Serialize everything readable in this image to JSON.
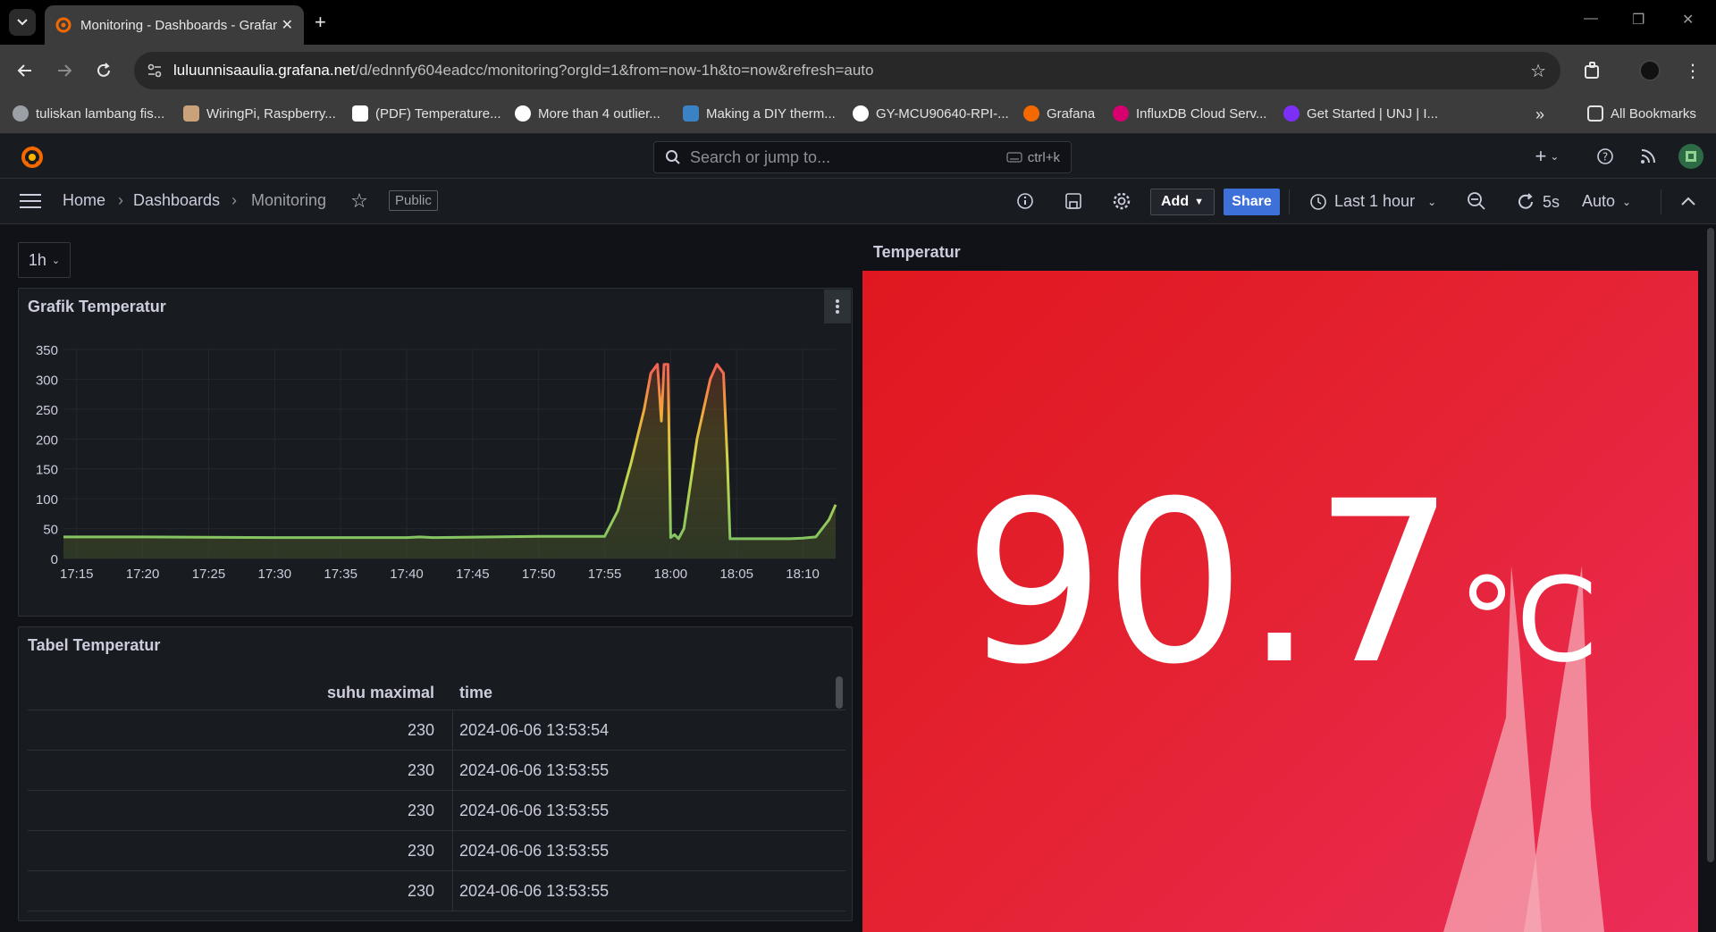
{
  "browser": {
    "tab_title": "Monitoring - Dashboards - Grafana",
    "url_host": "luluunnisaaulia.grafana.net",
    "url_path": "/d/ednnfy604eadcc/monitoring?orgId=1&from=now-1h&to=now&refresh=auto",
    "bookmarks": [
      "tuliskan lambang fis...",
      "WiringPi, Raspberry...",
      "(PDF) Temperature...",
      "More than 4 outlier...",
      "Making a DIY therm...",
      "GY-MCU90640-RPI-...",
      "Grafana",
      "InfluxDB Cloud Serv...",
      "Get Started | UNJ | I..."
    ],
    "all_bookmarks": "All Bookmarks"
  },
  "topbar": {
    "search_placeholder": "Search or jump to...",
    "shortcut": "ctrl+k"
  },
  "navbar": {
    "crumbs": [
      "Home",
      "Dashboards",
      "Monitoring"
    ],
    "public": "Public",
    "add": "Add",
    "share": "Share",
    "time_range": "Last 1 hour",
    "refresh_interval": "5s",
    "auto": "Auto"
  },
  "variable": {
    "value": "1h"
  },
  "graph_panel": {
    "title": "Grafik Temperatur",
    "chart_data": {
      "type": "line",
      "title": "Grafik Temperatur",
      "xlabel": "",
      "ylabel": "",
      "ylim": [
        0,
        350
      ],
      "y_ticks": [
        0,
        50,
        100,
        150,
        200,
        250,
        300,
        350
      ],
      "x_ticks": [
        "17:15",
        "17:20",
        "17:25",
        "17:30",
        "17:35",
        "17:40",
        "17:45",
        "17:50",
        "17:55",
        "18:00",
        "18:05",
        "18:10"
      ],
      "series": [
        {
          "x": [
            "17:14",
            "17:20",
            "17:30",
            "17:40",
            "17:41",
            "17:42",
            "17:50",
            "17:55",
            "17:56",
            "17:57",
            "17:58",
            "17:58.5",
            "17:59",
            "17:59.3",
            "17:59.5",
            "17:59.8",
            "18:00",
            "18:00.3",
            "18:00.6",
            "18:01",
            "18:02",
            "18:03",
            "18:03.5",
            "18:04",
            "18:04.3",
            "18:04.5",
            "18:04.7",
            "18:05",
            "18:08",
            "18:09",
            "18:10",
            "18:11",
            "18:12",
            "18:12.5"
          ],
          "y": [
            36,
            36,
            35,
            35,
            36,
            35,
            37,
            37,
            80,
            160,
            250,
            310,
            325,
            230,
            325,
            325,
            35,
            40,
            33,
            50,
            200,
            300,
            325,
            310,
            160,
            33,
            33,
            33,
            33,
            33,
            34,
            36,
            65,
            90
          ]
        }
      ]
    }
  },
  "table_panel": {
    "title": "Tabel Temperatur",
    "columns": [
      "suhu maximal",
      "time"
    ],
    "rows": [
      [
        "230",
        "2024-06-06 13:53:54"
      ],
      [
        "230",
        "2024-06-06 13:53:55"
      ],
      [
        "230",
        "2024-06-06 13:53:55"
      ],
      [
        "230",
        "2024-06-06 13:53:55"
      ],
      [
        "230",
        "2024-06-06 13:53:55"
      ]
    ]
  },
  "stat_panel": {
    "title": "Temperatur",
    "value": "90.7",
    "unit": "°C",
    "color_from": "#e0171f",
    "color_to": "#eb2d59"
  }
}
